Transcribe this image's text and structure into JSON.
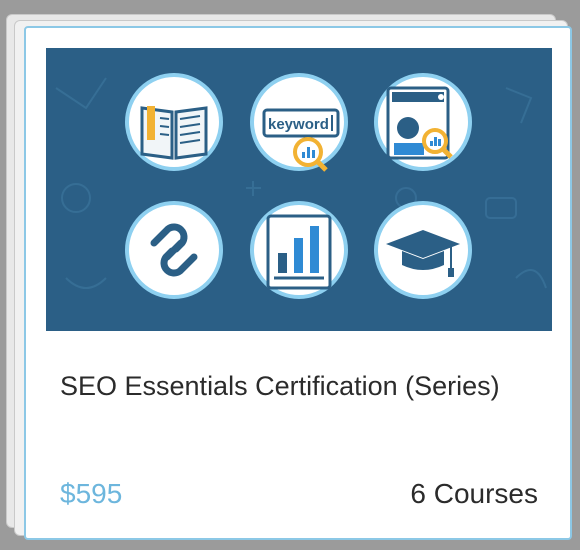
{
  "card": {
    "title": "SEO Essentials Certification (Series)",
    "price": "$595",
    "course_count": "6 Courses"
  },
  "hero": {
    "keyword_text": "keyword",
    "icons": [
      "book-icon",
      "keyword-search-icon",
      "webpage-analytics-icon",
      "link-icon",
      "bar-chart-icon",
      "graduation-cap-icon"
    ]
  },
  "colors": {
    "hero_bg": "#2b5f86",
    "price_blue": "#6db6dd",
    "circle_ring": "#8ed0f0",
    "accent_orange": "#f2b233"
  }
}
